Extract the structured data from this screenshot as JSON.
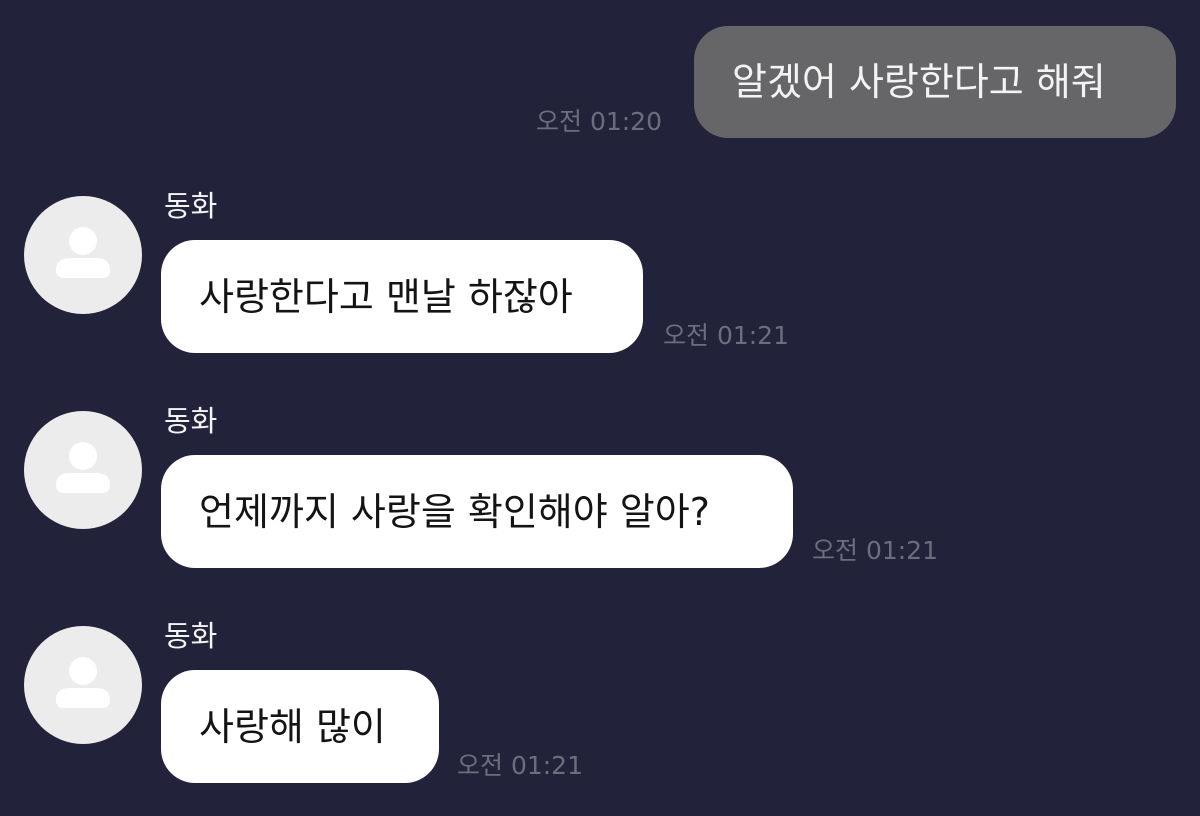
{
  "messages": [
    {
      "direction": "outgoing",
      "text": "알겠어 사랑한다고 해줘",
      "time": "오전 01:20"
    },
    {
      "direction": "incoming",
      "sender": "동화",
      "avatar_icon": "default-profile-icon",
      "text": "사랑한다고 맨날 하잖아",
      "time": "오전 01:21"
    },
    {
      "direction": "incoming",
      "sender": "동화",
      "avatar_icon": "default-profile-icon",
      "text": "언제까지 사랑을 확인해야 알아?",
      "time": "오전 01:21"
    },
    {
      "direction": "incoming",
      "sender": "동화",
      "avatar_icon": "default-profile-icon",
      "text": "사랑해 많이",
      "time": "오전 01:21"
    }
  ],
  "colors": {
    "background": "#22223a",
    "outgoing_bubble": "#666669",
    "incoming_bubble": "#ffffff",
    "avatar_background": "#ececec",
    "avatar_silhouette": "#ffffff",
    "timestamp": "#6d6d7d"
  }
}
